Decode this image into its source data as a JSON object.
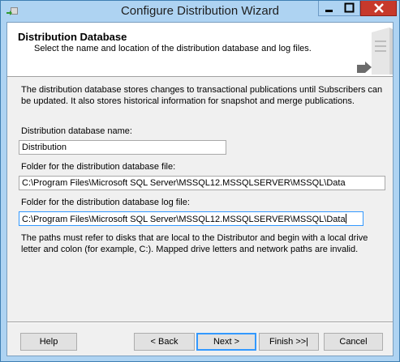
{
  "window": {
    "title": "Configure Distribution Wizard",
    "controls": [
      "minimize-icon",
      "maximize-icon",
      "close-icon"
    ]
  },
  "header": {
    "title": "Distribution Database",
    "subtitle": "Select the name and location of the distribution database and log files."
  },
  "description": "The distribution database stores changes to transactional publications until Subscribers can be updated. It also stores historical information for snapshot and merge publications.",
  "fields": {
    "db_name_label": "Distribution database name:",
    "db_name_value": "Distribution",
    "data_folder_label": "Folder for the distribution database file:",
    "data_folder_value": "C:\\Program Files\\Microsoft SQL Server\\MSSQL12.MSSQLSERVER\\MSSQL\\Data",
    "log_folder_label": "Folder for the distribution database log file:",
    "log_folder_value": "C:\\Program Files\\Microsoft SQL Server\\MSSQL12.MSSQLSERVER\\MSSQL\\Data"
  },
  "note": "The paths must refer to disks that are local to the Distributor and begin with a local drive letter and colon (for example, C:). Mapped drive letters and network paths are invalid.",
  "buttons": {
    "help": "Help",
    "back": "< Back",
    "next": "Next >",
    "finish": "Finish >>|",
    "cancel": "Cancel"
  },
  "colors": {
    "title_bar": "#aed3f2",
    "close_button": "#c7392b",
    "focus_border": "#3399ff"
  }
}
